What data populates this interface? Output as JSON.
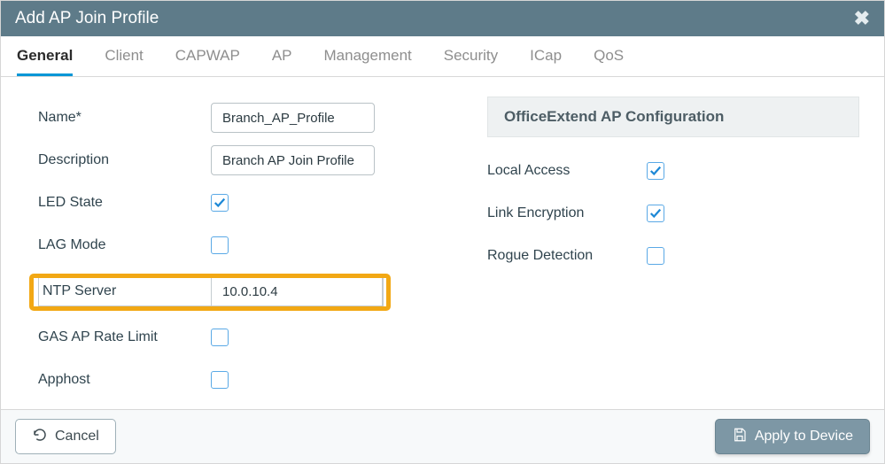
{
  "header": {
    "title": "Add AP Join Profile"
  },
  "tabs": {
    "items": [
      {
        "label": "General",
        "active": true
      },
      {
        "label": "Client"
      },
      {
        "label": "CAPWAP"
      },
      {
        "label": "AP"
      },
      {
        "label": "Management"
      },
      {
        "label": "Security"
      },
      {
        "label": "ICap"
      },
      {
        "label": "QoS"
      }
    ]
  },
  "form": {
    "name_label": "Name*",
    "name_value": "Branch_AP_Profile",
    "description_label": "Description",
    "description_value": "Branch AP Join Profile",
    "led_state_label": "LED State",
    "led_state_checked": true,
    "lag_mode_label": "LAG Mode",
    "lag_mode_checked": false,
    "ntp_server_label": "NTP Server",
    "ntp_server_value": "10.0.10.4",
    "gas_rate_label": "GAS AP Rate Limit",
    "gas_rate_checked": false,
    "apphost_label": "Apphost",
    "apphost_checked": false
  },
  "office_extend": {
    "heading": "OfficeExtend AP Configuration",
    "local_access_label": "Local Access",
    "local_access_checked": true,
    "link_encryption_label": "Link Encryption",
    "link_encryption_checked": true,
    "rogue_detection_label": "Rogue Detection",
    "rogue_detection_checked": false
  },
  "footer": {
    "cancel_label": "Cancel",
    "apply_label": "Apply to Device"
  }
}
